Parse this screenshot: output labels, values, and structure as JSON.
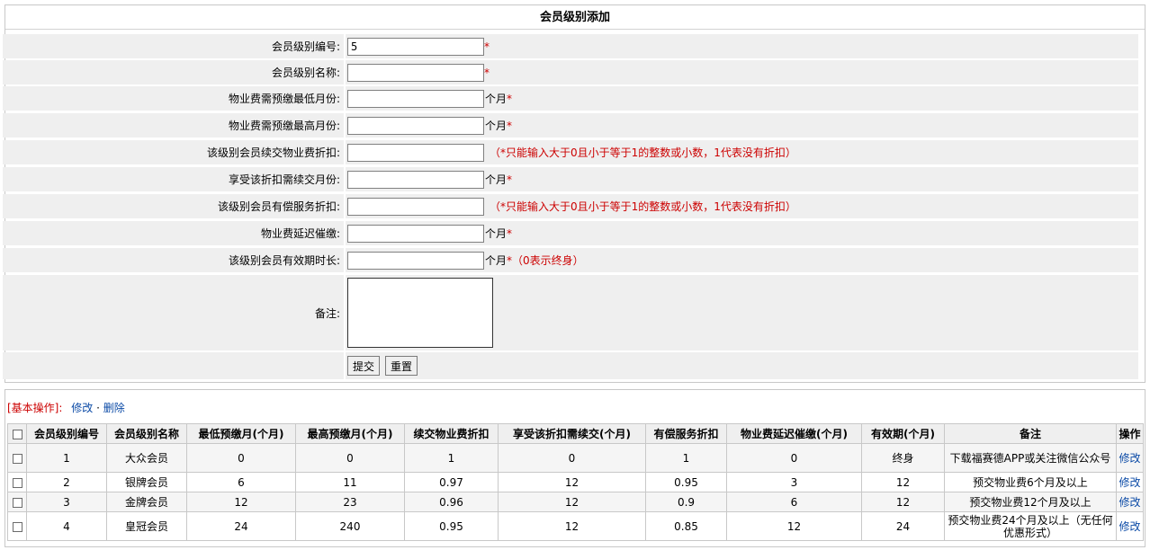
{
  "form": {
    "title": "会员级别添加",
    "rows": [
      {
        "label": "会员级别编号:",
        "value": "5",
        "unit": "",
        "required": "*",
        "hint": ""
      },
      {
        "label": "会员级别名称:",
        "value": "",
        "unit": "",
        "required": "*",
        "hint": ""
      },
      {
        "label": "物业费需预缴最低月份:",
        "value": "",
        "unit": "个月",
        "required": "*",
        "hint": ""
      },
      {
        "label": "物业费需预缴最高月份:",
        "value": "",
        "unit": "个月",
        "required": "*",
        "hint": ""
      },
      {
        "label": "该级别会员续交物业费折扣:",
        "value": "",
        "unit": "",
        "required": "",
        "hint": "（*只能输入大于0且小于等于1的整数或小数，1代表没有折扣）"
      },
      {
        "label": "享受该折扣需续交月份:",
        "value": "",
        "unit": "个月",
        "required": "*",
        "hint": ""
      },
      {
        "label": "该级别会员有偿服务折扣:",
        "value": "",
        "unit": "",
        "required": "",
        "hint": "（*只能输入大于0且小于等于1的整数或小数，1代表没有折扣）"
      },
      {
        "label": "物业费延迟催缴:",
        "value": "",
        "unit": "个月",
        "required": "*",
        "hint": ""
      },
      {
        "label": "该级别会员有效期时长:",
        "value": "",
        "unit": "个月",
        "required": "*",
        "hint": "（0表示终身）"
      }
    ],
    "note_label": "备注:",
    "note_value": "",
    "submit_label": "提交",
    "reset_label": "重置"
  },
  "ops": {
    "prefix": "[基本操作]:",
    "edit_label": "修改",
    "separator": "·",
    "delete_label": "删除"
  },
  "table": {
    "headers": [
      "会员级别编号",
      "会员级别名称",
      "最低预缴月(个月)",
      "最高预缴月(个月)",
      "续交物业费折扣",
      "享受该折扣需续交(个月)",
      "有偿服务折扣",
      "物业费延迟催缴(个月)",
      "有效期(个月)",
      "备注",
      "操作"
    ],
    "rows": [
      [
        "1",
        "大众会员",
        "0",
        "0",
        "1",
        "0",
        "1",
        "0",
        "终身",
        "下载福赛德APP或关注微信公众号",
        "修改"
      ],
      [
        "2",
        "银牌会员",
        "6",
        "11",
        "0.97",
        "12",
        "0.95",
        "3",
        "12",
        "预交物业费6个月及以上",
        "修改"
      ],
      [
        "3",
        "金牌会员",
        "12",
        "23",
        "0.96",
        "12",
        "0.9",
        "6",
        "12",
        "预交物业费12个月及以上",
        "修改"
      ],
      [
        "4",
        "皇冠会员",
        "24",
        "240",
        "0.95",
        "12",
        "0.85",
        "12",
        "24",
        "预交物业费24个月及以上（无任何优惠形式）",
        "修改"
      ]
    ]
  }
}
